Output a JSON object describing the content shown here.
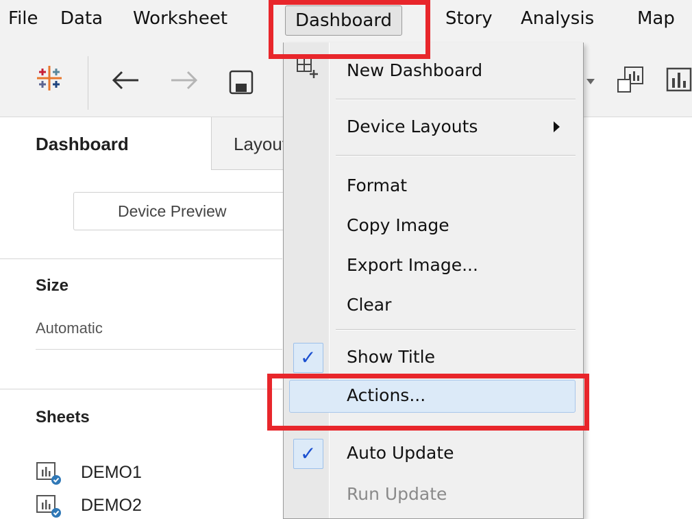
{
  "menubar": {
    "items": [
      "File",
      "Data",
      "Worksheet",
      "Dashboard",
      "Story",
      "Analysis",
      "Map"
    ],
    "active": "Dashboard"
  },
  "toolbar": {
    "icons": [
      "tableau-logo-icon",
      "back-arrow-icon",
      "forward-arrow-icon",
      "save-icon",
      "dropdown-caret-icon",
      "show-me-icon",
      "bar-chart-icon"
    ]
  },
  "left_pane": {
    "tabs": [
      "Dashboard",
      "Layout"
    ],
    "device_preview_label": "Device Preview",
    "size_title": "Size",
    "size_value": "Automatic",
    "sheets_title": "Sheets",
    "sheets": [
      "DEMO1",
      "DEMO2"
    ]
  },
  "dropdown": {
    "items": [
      {
        "label": "New Dashboard",
        "icon": "new-dashboard-icon"
      },
      {
        "label": "Device Layouts",
        "submenu": true
      },
      {
        "label": "Format"
      },
      {
        "label": "Copy Image"
      },
      {
        "label": "Export Image..."
      },
      {
        "label": "Clear"
      },
      {
        "label": "Show Title",
        "checked": true
      },
      {
        "label": "Actions...",
        "highlighted": true
      },
      {
        "label": "Auto Update",
        "checked": true
      },
      {
        "label": "Run Update",
        "disabled": true
      }
    ],
    "check_mark": "✓"
  },
  "colors": {
    "highlight_box": "#e8262b",
    "hover_bg": "#dceaf8",
    "check": "#1a4fd0",
    "menubar_bg": "#f2f2f2"
  }
}
